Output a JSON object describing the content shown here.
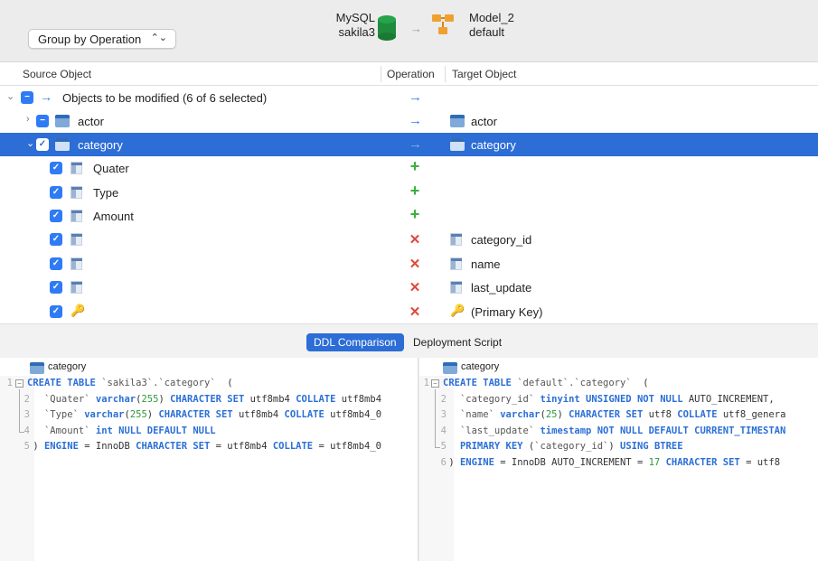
{
  "header": {
    "group_select": "Group by Operation",
    "source": {
      "db": "MySQL",
      "schema": "sakila3"
    },
    "target": {
      "model": "Model_2",
      "schema": "default"
    }
  },
  "columns": {
    "source": "Source Object",
    "operation": "Operation",
    "target": "Target Object"
  },
  "tree": {
    "group_label": "Objects to be modified (6 of 6 selected)",
    "actor": {
      "source": "actor",
      "target": "actor"
    },
    "category": {
      "source": "category",
      "target": "category"
    },
    "fields": [
      {
        "source": "Quater",
        "op": "add",
        "target": ""
      },
      {
        "source": "Type",
        "op": "add",
        "target": ""
      },
      {
        "source": "Amount",
        "op": "add",
        "target": ""
      },
      {
        "source": "",
        "op": "delete",
        "target": "category_id"
      },
      {
        "source": "",
        "op": "delete",
        "target": "name"
      },
      {
        "source": "",
        "op": "delete",
        "target": "last_update"
      },
      {
        "source": "",
        "op": "delete",
        "target": "(Primary Key)"
      }
    ]
  },
  "tabs": {
    "ddl": "DDL Comparison",
    "deploy": "Deployment Script"
  },
  "left_pane": {
    "title": "category",
    "line_numbers": [
      "1",
      "2",
      "3",
      "4",
      "5"
    ]
  },
  "right_pane": {
    "title": "category",
    "line_numbers": [
      "1",
      "2",
      "3",
      "4",
      "5",
      "6"
    ]
  }
}
